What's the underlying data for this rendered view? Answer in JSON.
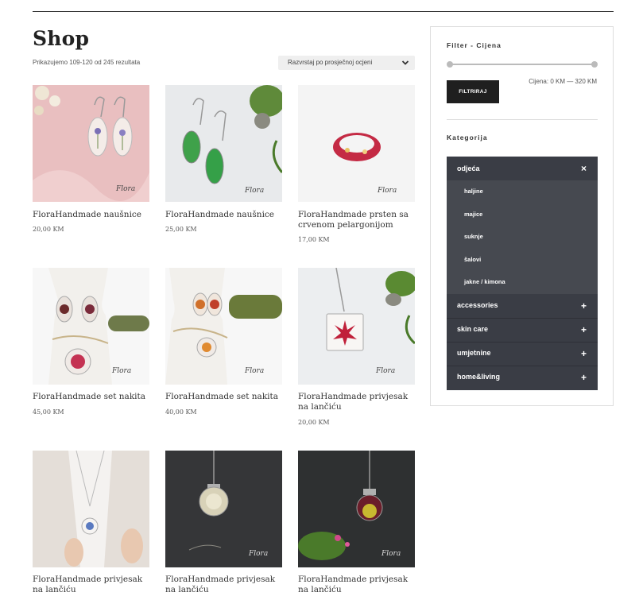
{
  "shop": {
    "title": "Shop",
    "result_count": "Prikazujemo 109-120 od 245 rezultata",
    "sort_label": "Razvrstaj po prosječnoj ocjeni"
  },
  "products": [
    {
      "name": "FloraHandmade naušnice",
      "price": "20,00 KM"
    },
    {
      "name": "FloraHandmade naušnice",
      "price": "25,00 KM"
    },
    {
      "name": "FloraHandmade prsten sa crvenom pelargonijom",
      "price": "17,00 KM"
    },
    {
      "name": "FloraHandmade set nakita",
      "price": "45,00 KM"
    },
    {
      "name": "FloraHandmade set nakita",
      "price": "40,00 KM"
    },
    {
      "name": "FloraHandmade privjesak na lančiću",
      "price": "20,00 KM"
    },
    {
      "name": "FloraHandmade privjesak na lančiću",
      "price": ""
    },
    {
      "name": "FloraHandmade privjesak na lančiću",
      "price": ""
    },
    {
      "name": "FloraHandmade privjesak na lančiću",
      "price": ""
    }
  ],
  "filter": {
    "title": "Filter - Cijena",
    "button_label": "FILTRIRAJ",
    "range_text": "Cijena: 0 KM — 320 KM"
  },
  "categories": {
    "title": "Kategorija",
    "open": {
      "label": "odjeća",
      "sign": "×"
    },
    "sub": [
      "haljine",
      "majice",
      "suknje",
      "šalovi",
      "jakne / kimona"
    ],
    "others": [
      {
        "label": "accessories",
        "sign": "+"
      },
      {
        "label": "skin care",
        "sign": "+"
      },
      {
        "label": "umjetnine",
        "sign": "+"
      },
      {
        "label": "home&living",
        "sign": "+"
      }
    ]
  },
  "icons": {
    "sort": "chevron-down-icon"
  }
}
